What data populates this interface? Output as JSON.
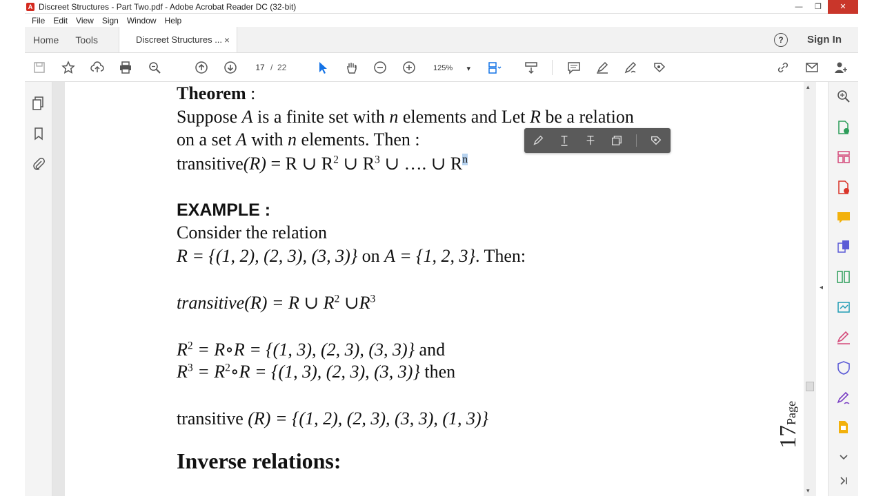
{
  "window": {
    "title": "Discreet Structures - Part Two.pdf - Adobe Acrobat Reader DC (32-bit)",
    "min": "—",
    "restore": "❐",
    "close": "✕"
  },
  "menu": [
    "File",
    "Edit",
    "View",
    "Sign",
    "Window",
    "Help"
  ],
  "tabs": {
    "home": "Home",
    "tools": "Tools",
    "doc": "Discreet Structures ...",
    "close": "×",
    "help": "?",
    "sign_in": "Sign In"
  },
  "toolbar": {
    "page_current": "17",
    "page_sep": "/",
    "page_total": "22",
    "zoom": "125%",
    "zoom_caret": "▾"
  },
  "rails": {
    "left_toggle": "◂",
    "right_toggle": "◂",
    "scroll_up": "▴",
    "scroll_down": "▾"
  },
  "document": {
    "theorem_title": "Theorem",
    "theorem_colon": " :",
    "line1_a": "Suppose ",
    "line1_A": "A",
    "line1_b": " is a finite set with ",
    "line1_n": "n",
    "line1_c": " elements and Let ",
    "line1_R": "R",
    "line1_d": " be a relation",
    "line2_a": "on a set ",
    "line2_A": "A",
    "line2_b": " with ",
    "line2_n": "n",
    "line2_c": " elements. Then :",
    "formula_prefix": " transitive",
    "formula_R": "(R)",
    "formula_body": " = R ∪  R",
    "exp2": "2",
    "formula_mid": " ∪ R",
    "exp3": "3",
    "formula_tail": " ∪ …. ∪ R",
    "exp_n": "n",
    "example_title": "EXAMPLE :",
    "consider": "Consider the relation",
    "rel_def": "R = {(1, 2), (2, 3), (3, 3)}",
    "rel_on": " on ",
    "rel_A": "A",
    "rel_set": " = {1, 2, 3}",
    "rel_then": ". Then:",
    "trans_line": "transitive(R) = R ∪ R",
    "trans_exp2": "2",
    "trans_mid": " ∪R",
    "trans_exp3": "3",
    "r2_R": "R",
    "r2_exp": "2",
    "r2_body": " = R∘R = {(1, 3), (2, 3), (3, 3)}",
    "r2_and": " and",
    "r3_R": "R",
    "r3_exp": "3",
    "r3_eq": " = R",
    "r3_exp2": "2",
    "r3_body": "∘R = {(1, 3), (2, 3), (3, 3)}",
    "r3_then": " then",
    "result_a": "transitive ",
    "result_b": "(R) = {(1, 2), (2, 3), (3, 3), (1, 3)}",
    "inverse_title": "Inverse relations:",
    "page_number": "17",
    "page_label": "Page"
  }
}
